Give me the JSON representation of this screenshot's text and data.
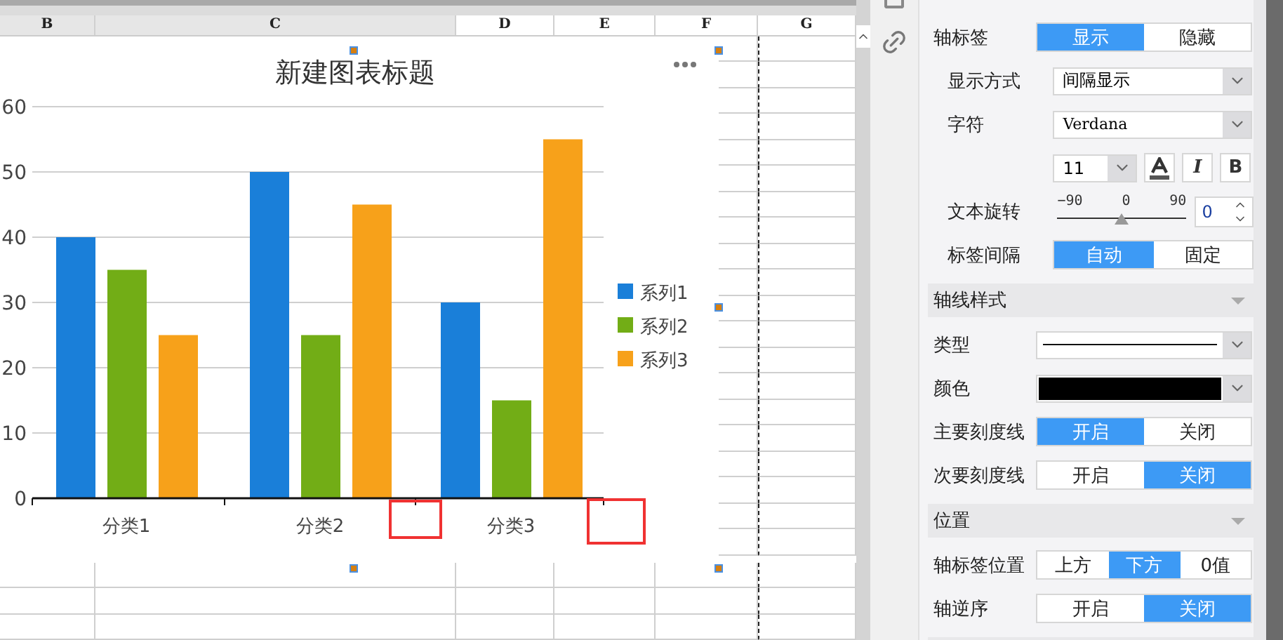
{
  "sheet": {
    "columns": [
      {
        "label": "B",
        "selected": true
      },
      {
        "label": "C",
        "selected": true
      },
      {
        "label": "D",
        "selected": false
      },
      {
        "label": "E",
        "selected": false
      },
      {
        "label": "F",
        "selected": false
      },
      {
        "label": "G",
        "selected": false
      }
    ]
  },
  "chart": {
    "chart_data": {
      "type": "bar",
      "title": "新建图表标题",
      "categories": [
        "分类1",
        "分类2",
        "分类3"
      ],
      "series": [
        {
          "name": "系列1",
          "color": "#1a7fd9",
          "values": [
            40,
            50,
            30
          ]
        },
        {
          "name": "系列2",
          "color": "#72ad16",
          "values": [
            35,
            25,
            15
          ]
        },
        {
          "name": "系列3",
          "color": "#f7a11a",
          "values": [
            25,
            45,
            55
          ]
        }
      ],
      "ylim": [
        0,
        60
      ],
      "yticks": [
        0,
        10,
        20,
        30,
        40,
        50,
        60
      ],
      "grid": true,
      "legend": true
    }
  },
  "panel": {
    "rows": [
      {
        "kind": "toggle",
        "label": "轴标签",
        "options": [
          {
            "label": "显示",
            "selected": true
          },
          {
            "label": "隐藏",
            "selected": false
          }
        ],
        "children": [
          {
            "kind": "dropdown",
            "label": "显示方式",
            "value": "间隔显示"
          },
          {
            "kind": "font",
            "label": "字符",
            "value": "Verdana"
          },
          {
            "kind": "font_style",
            "size": "11",
            "italic": "I",
            "bold": "B"
          },
          {
            "kind": "rotation",
            "label": "文本旋转",
            "ticks": [
              "−90",
              "0",
              "90"
            ],
            "level": 0.5,
            "value": "0"
          },
          {
            "kind": "toggle",
            "label": "标签间隔",
            "options": [
              {
                "label": "自动",
                "selected": true
              },
              {
                "label": "固定",
                "selected": false
              }
            ]
          }
        ]
      },
      {
        "kind": "section",
        "label": "轴线样式"
      },
      {
        "kind": "line_select",
        "label": "类型"
      },
      {
        "kind": "color_select",
        "label": "颜色",
        "color": "#000000"
      },
      {
        "kind": "toggle",
        "label": "主要刻度线",
        "options": [
          {
            "label": "开启",
            "selected": true
          },
          {
            "label": "关闭",
            "selected": false
          }
        ]
      },
      {
        "kind": "toggle",
        "label": "次要刻度线",
        "options": [
          {
            "label": "开启",
            "selected": false
          },
          {
            "label": "关闭",
            "selected": true
          }
        ]
      },
      {
        "kind": "section",
        "label": "位置"
      },
      {
        "kind": "toggle",
        "label": "轴标签位置",
        "options": [
          {
            "label": "上方",
            "selected": false
          },
          {
            "label": "下方",
            "selected": true
          },
          {
            "label": "0值",
            "selected": false
          }
        ]
      },
      {
        "kind": "toggle",
        "label": "轴逆序",
        "options": [
          {
            "label": "开启",
            "selected": false
          },
          {
            "label": "关闭",
            "selected": true
          }
        ]
      },
      {
        "kind": "section"
      }
    ]
  }
}
